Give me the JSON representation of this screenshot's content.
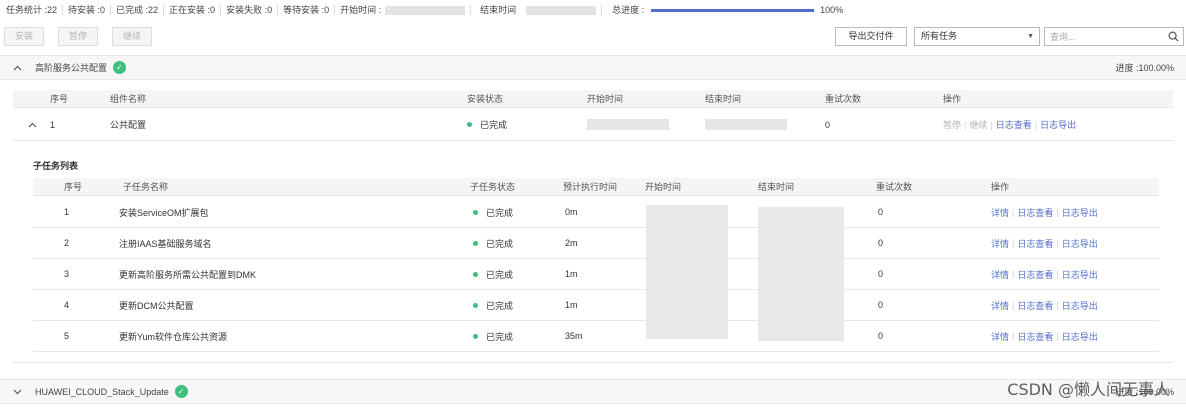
{
  "statusbar": {
    "total": "任务统计 :22",
    "pending": "待安装 :0",
    "completed": "已完成 :22",
    "installing": "正在安装 :0",
    "failed": "安装失败 :0",
    "waiting": "等待安装 :0",
    "start_time_label": "开始时间 :",
    "end_time_label": "结束时间",
    "progress_label": "总进度 :",
    "progress_value": 100,
    "progress_text": "100%",
    "progress_color": "#526ecc"
  },
  "toolbar": {
    "install": "安装",
    "pause": "暂停",
    "resume": "继续",
    "export": "导出交付件",
    "select_value": "所有任务",
    "search_placeholder": "查询..."
  },
  "group1": {
    "name": "高阶服务公共配置",
    "status_icon": "check-circle-icon",
    "progress": "进度 :100.00%",
    "columns": [
      "序号",
      "组件名称",
      "安装状态",
      "开始时间",
      "结束时间",
      "重试次数",
      "操作"
    ],
    "row": {
      "index": "1",
      "name": "公共配置",
      "status": "已完成",
      "retries": "0",
      "op_pause": "暂停",
      "op_resume": "继续",
      "op_view_log": "日志查看",
      "op_export_log": "日志导出"
    }
  },
  "subtasks": {
    "title": "子任务列表",
    "columns": [
      "序号",
      "子任务名称",
      "子任务状态",
      "预计执行时间",
      "开始时间",
      "结束时间",
      "重试次数",
      "操作"
    ],
    "rows": [
      {
        "index": "1",
        "name": "安装ServiceOM扩展包",
        "status": "已完成",
        "eta": "0m",
        "retries": "0"
      },
      {
        "index": "2",
        "name": "注册IAAS基础服务域名",
        "status": "已完成",
        "eta": "2m",
        "retries": "0"
      },
      {
        "index": "3",
        "name": "更新高阶服务所需公共配置到DMK",
        "status": "已完成",
        "eta": "1m",
        "retries": "0"
      },
      {
        "index": "4",
        "name": "更新DCM公共配置",
        "status": "已完成",
        "eta": "1m",
        "retries": "0"
      },
      {
        "index": "5",
        "name": "更新Yum软件仓库公共资源",
        "status": "已完成",
        "eta": "35m",
        "retries": "0"
      }
    ],
    "op_detail": "详情",
    "op_view_log": "日志查看",
    "op_export_log": "日志导出"
  },
  "group2": {
    "name": "HUAWEI_CLOUD_Stack_Update",
    "status_icon": "check-circle-icon",
    "progress": "进度 :100.00%"
  },
  "watermark": "CSDN @懒人间无事人",
  "colors": {
    "success": "#3fbf7f",
    "link": "#526ecc"
  }
}
